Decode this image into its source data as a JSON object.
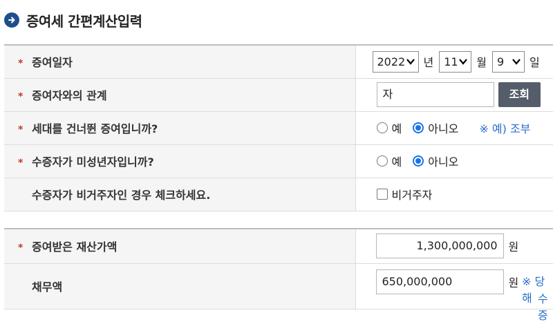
{
  "page": {
    "title": "증여세 간편계산입력"
  },
  "rows1": {
    "date": {
      "label": "증여일자",
      "year": "2022",
      "year_unit": "년",
      "month": "11",
      "month_unit": "월",
      "day": "9",
      "day_unit": "일"
    },
    "relation": {
      "label": "증여자와의 관계",
      "value": "자",
      "button": "조회"
    },
    "generation_skip": {
      "label": "세대를 건너뛴 증여입니까?",
      "opt_yes": "예",
      "opt_no": "아니오",
      "selected": "아니오",
      "note": "※ 예) 조부"
    },
    "minor": {
      "label": "수증자가 미성년자입니까?",
      "opt_yes": "예",
      "opt_no": "아니오",
      "selected": "아니오"
    },
    "nonresident": {
      "label": "수증자가 비거주자인 경우 체크하세요.",
      "checkbox_label": "비거주자",
      "checked": false
    }
  },
  "rows2": {
    "gift_amount": {
      "label": "증여받은 재산가액",
      "value": "1,300,000,000",
      "unit": "원"
    },
    "debt": {
      "label": "채무액",
      "value": "650,000,000",
      "unit": "원",
      "note_line1": "※ 당해",
      "note_line2": "수증"
    }
  },
  "colors": {
    "accent": "#1a73e8",
    "required": "#c0392b",
    "button_bg": "#555c6a",
    "title_icon": "#1f4e8c"
  }
}
